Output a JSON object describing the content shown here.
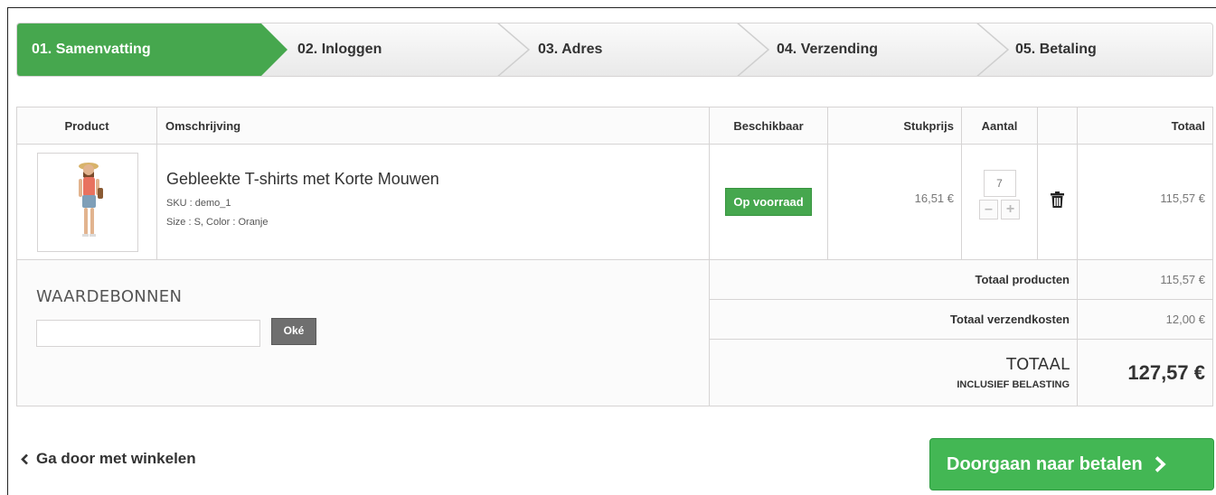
{
  "steps": [
    {
      "label": "01. Samenvatting"
    },
    {
      "label": "02. Inloggen"
    },
    {
      "label": "03. Adres"
    },
    {
      "label": "04. Verzending"
    },
    {
      "label": "05. Betaling"
    }
  ],
  "cart": {
    "headers": {
      "product": "Product",
      "description": "Omschrijving",
      "availability": "Beschikbaar",
      "unit_price": "Stukprijs",
      "quantity": "Aantal",
      "total": "Totaal"
    },
    "item": {
      "name": "Gebleekte T-shirts met Korte Mouwen",
      "sku": "SKU : demo_1",
      "attributes": "Size : S, Color : Oranje",
      "availability": "Op voorraad",
      "unit_price": "16,51 €",
      "quantity": "7",
      "total": "115,57 €"
    },
    "vouchers": {
      "title": "WAARDEBONNEN",
      "input_value": "",
      "button": "Oké"
    },
    "summary": {
      "products_label": "Totaal producten",
      "products_value": "115,57 €",
      "shipping_label": "Totaal verzendkosten",
      "shipping_value": "12,00 €",
      "total_label": "TOTAAL",
      "total_sublabel": "INCLUSIEF BELASTING",
      "total_value": "127,57 €"
    }
  },
  "actions": {
    "continue_shopping": "Ga door met winkelen",
    "checkout": "Doorgaan naar betalen"
  },
  "colors": {
    "accent_green": "#46a74e",
    "checkout_green": "#43b754"
  },
  "icons": [
    "chevron-left-icon",
    "chevron-right-icon",
    "trash-icon",
    "minus-icon",
    "plus-icon"
  ]
}
